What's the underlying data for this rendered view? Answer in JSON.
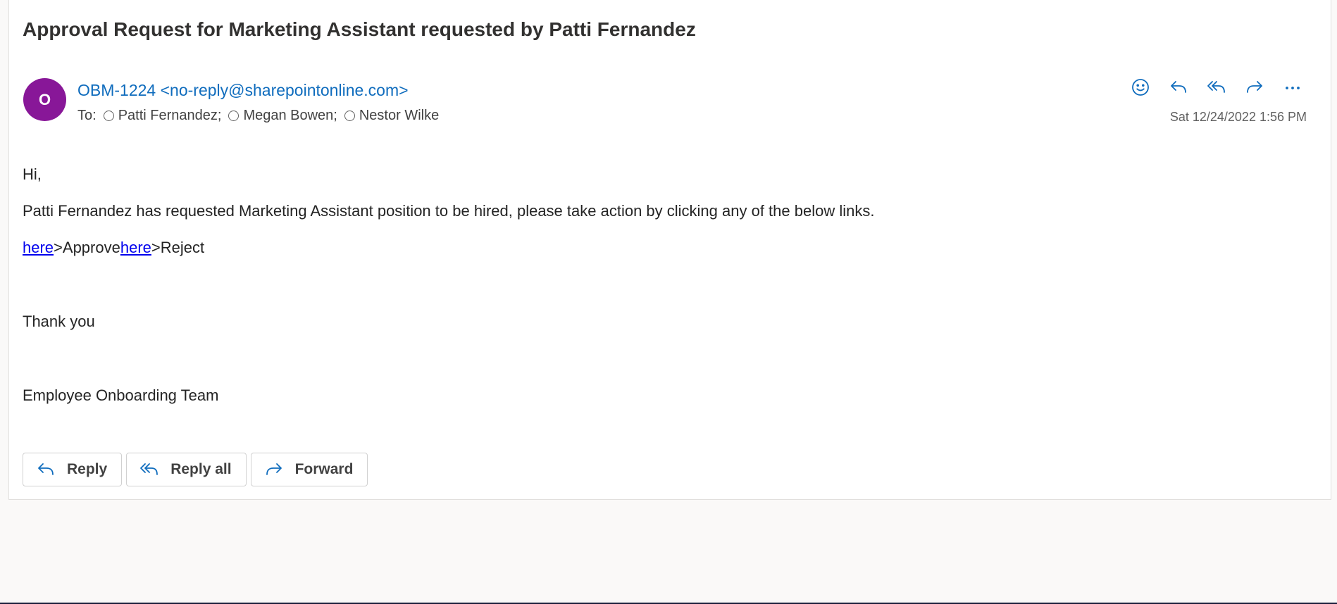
{
  "email": {
    "subject": "Approval Request for Marketing Assistant requested by Patti Fernandez",
    "avatar_initial": "O",
    "avatar_color": "#881798",
    "sender": "OBM-1224 <no-reply@sharepointonline.com>",
    "to_label": "To:",
    "recipients": [
      "Patti Fernandez;",
      "Megan Bowen;",
      "Nestor Wilke"
    ],
    "timestamp": "Sat 12/24/2022 1:56 PM"
  },
  "header_actions": [
    {
      "name": "emoji-icon",
      "label": "React"
    },
    {
      "name": "reply-icon",
      "label": "Reply"
    },
    {
      "name": "reply-all-icon",
      "label": "Reply all"
    },
    {
      "name": "forward-icon",
      "label": "Forward"
    },
    {
      "name": "more-icon",
      "label": "More actions"
    }
  ],
  "body": {
    "greeting": "Hi,",
    "message": "Patti Fernandez has requested Marketing Assistant position to be hired, please take action by clicking any of the below links.",
    "approve_link": "here",
    "approve_text": ">Approve",
    "reject_link": "here",
    "reject_text": ">Reject",
    "thanks": "Thank you",
    "signature": "Employee Onboarding Team"
  },
  "footer": {
    "reply_label": "Reply",
    "reply_all_label": "Reply all",
    "forward_label": "Forward"
  },
  "colors": {
    "accent": "#0f6cbd",
    "link": "#0000ee"
  }
}
